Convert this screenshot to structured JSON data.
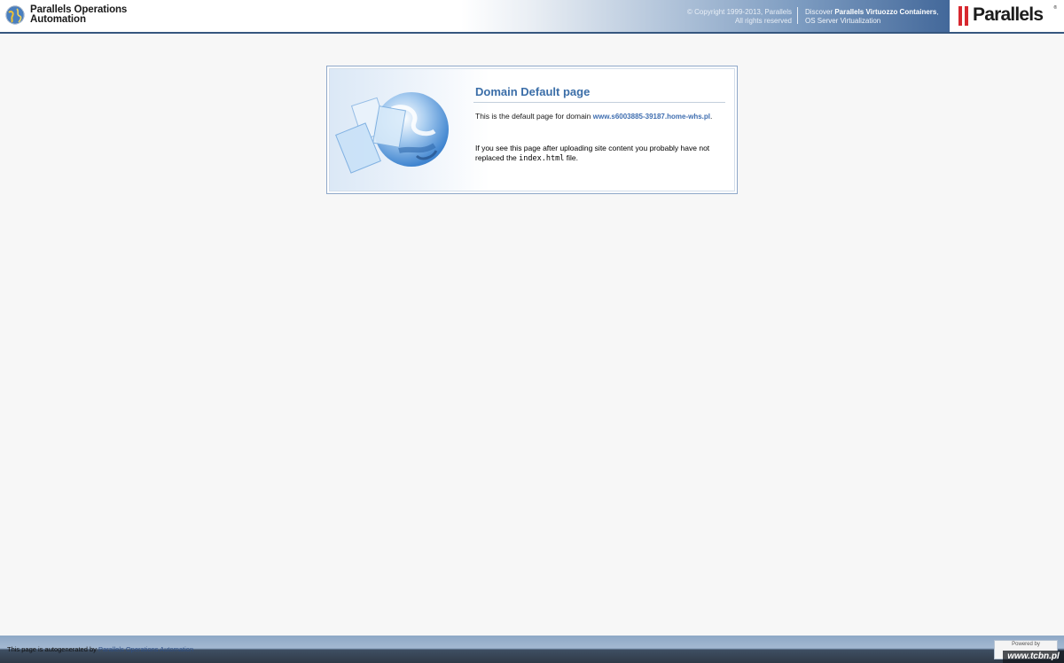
{
  "header": {
    "product_line1": "Parallels Operations",
    "product_line2": "Automation",
    "copyright_line1": "© Copyright 1999-2013, Parallels",
    "copyright_line2": "All rights reserved",
    "discover_prefix": "Discover ",
    "discover_bold": "Parallels Virtuozzo Containers",
    "discover_comma": ",",
    "discover_line2": "OS Server Virtualization",
    "logo_text": "Parallels",
    "logo_reg": "®"
  },
  "content": {
    "title": "Domain Default page",
    "para1_prefix": "This is the default page for domain ",
    "domain": "www.s6003885-39187.home-whs.pl",
    "para1_suffix": ".",
    "para2_prefix": "If you see this page after uploading site content you probably have not replaced the ",
    "filename": "index.html",
    "para2_suffix": " file."
  },
  "footer": {
    "autogen_prefix": "This page is autogenerated by ",
    "autogen_link": "Parallels Operations Automation",
    "powered_by": "Powered by"
  },
  "watermark": "www.tcbn.pl",
  "colors": {
    "title_blue": "#3b6ea8",
    "link_blue": "#3f6eb0",
    "header_dark": "#43689a",
    "logo_red": "#d7282f"
  }
}
